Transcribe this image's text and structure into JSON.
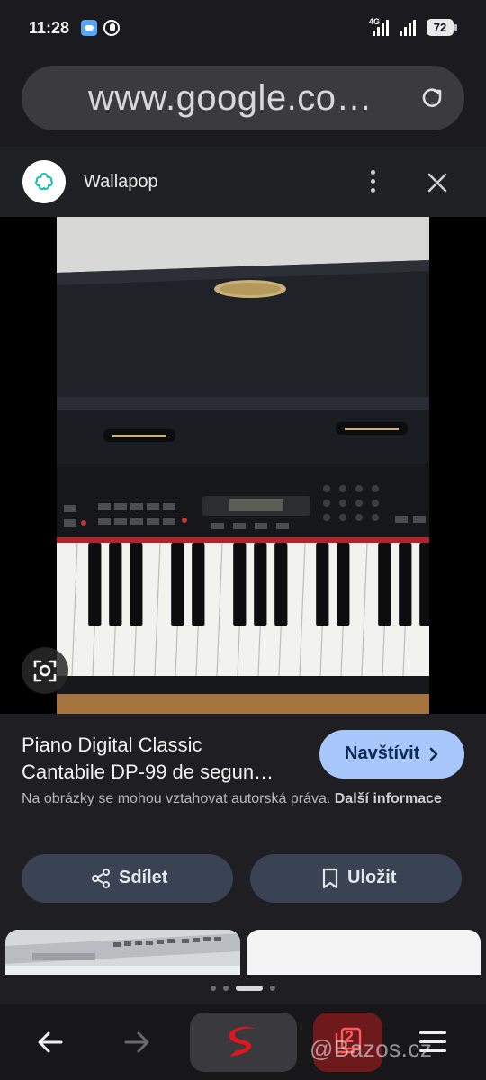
{
  "status": {
    "time": "11:28",
    "network": "4G",
    "battery": "72",
    "icons": [
      "weather-app-icon",
      "phone-call-icon",
      "signal-icon",
      "wifi-signal-icon",
      "battery-icon"
    ]
  },
  "browser": {
    "url": "www.google.co…",
    "reload_icon": "reload-icon"
  },
  "source": {
    "name": "Wallapop",
    "menu_icon": "more-vert-icon",
    "close_icon": "close-icon",
    "logo_color": "#13c1ac"
  },
  "result": {
    "title_line1": "Piano Digital Classic",
    "title_line2": "Cantabile DP-99 de segun…",
    "visit_label": "Navštívit",
    "copyright_text": "Na obrázky se mohou vztahovat autorská práva.",
    "more_info_label": "Další informace",
    "share_label": "Sdílet",
    "save_label": "Uložit",
    "lens_icon": "lens-search-icon"
  },
  "pager": {
    "count": 4,
    "active": 2
  },
  "bottom_nav": {
    "items": [
      "back-icon",
      "forward-icon",
      "browser-s-icon",
      "tabs-icon",
      "menu-icon"
    ],
    "tab_count": "2"
  },
  "watermark": "@Bazos.cz",
  "colors": {
    "accent_button": "#a8c7fa",
    "secondary_button": "#394353",
    "background": "#1f1f23",
    "tabs_button": "#6e1a1d"
  }
}
